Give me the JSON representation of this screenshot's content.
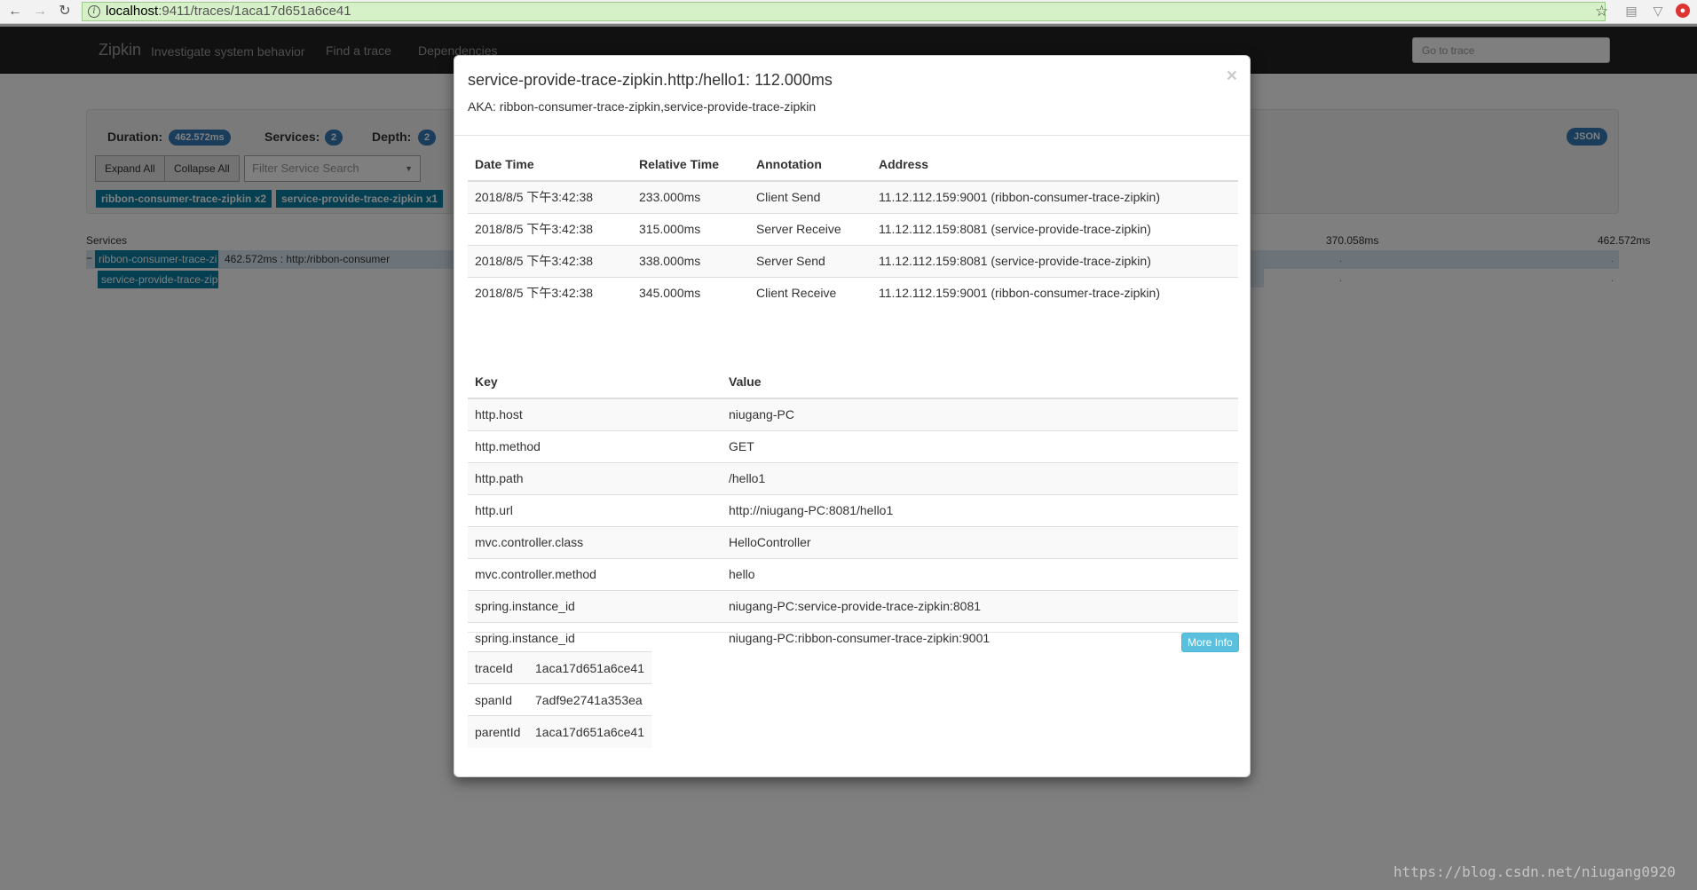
{
  "browser": {
    "back_glyph": "←",
    "forward_glyph": "→",
    "reload_glyph": "↻",
    "url_host": "localhost",
    "url_path": ":9411/traces/1aca17d651a6ce41",
    "star_glyph": "☆"
  },
  "navbar": {
    "brand": "Zipkin",
    "tagline": "Investigate system behavior",
    "links": [
      "Find a trace",
      "Dependencies"
    ],
    "goto_placeholder": "Go to trace"
  },
  "trace_summary": {
    "duration_label": "Duration:",
    "duration_value": "462.572ms",
    "services_label": "Services:",
    "services_value": "2",
    "depth_label": "Depth:",
    "depth_value": "2",
    "expand_all": "Expand All",
    "collapse_all": "Collapse All",
    "filter_placeholder": "Filter Service Search",
    "json_label": "JSON",
    "service_tags": [
      "ribbon-consumer-trace-zipkin x2",
      "service-provide-trace-zipkin x1"
    ]
  },
  "timeline": {
    "services_label": "Services",
    "ticks": [
      "370.058ms",
      "462.572ms"
    ],
    "rows": [
      {
        "service": "ribbon-consumer-trace-zi",
        "label": "462.572ms : http:/ribbon-consumer"
      },
      {
        "service": "service-provide-trace-zipk",
        "label": ""
      }
    ],
    "collapse_glyph": "−"
  },
  "modal": {
    "title": "service-provide-trace-zipkin.http:/hello1: 112.000ms",
    "aka": "AKA: ribbon-consumer-trace-zipkin,service-provide-trace-zipkin",
    "close_glyph": "×",
    "annotations": {
      "headers": [
        "Date Time",
        "Relative Time",
        "Annotation",
        "Address"
      ],
      "rows": [
        [
          "2018/8/5 下午3:42:38",
          "233.000ms",
          "Client Send",
          "11.12.112.159:9001 (ribbon-consumer-trace-zipkin)"
        ],
        [
          "2018/8/5 下午3:42:38",
          "315.000ms",
          "Server Receive",
          "11.12.112.159:8081 (service-provide-trace-zipkin)"
        ],
        [
          "2018/8/5 下午3:42:38",
          "338.000ms",
          "Server Send",
          "11.12.112.159:8081 (service-provide-trace-zipkin)"
        ],
        [
          "2018/8/5 下午3:42:38",
          "345.000ms",
          "Client Receive",
          "11.12.112.159:9001 (ribbon-consumer-trace-zipkin)"
        ]
      ]
    },
    "tags": {
      "headers": [
        "Key",
        "Value"
      ],
      "rows": [
        [
          "http.host",
          "niugang-PC"
        ],
        [
          "http.method",
          "GET"
        ],
        [
          "http.path",
          "/hello1"
        ],
        [
          "http.url",
          "http://niugang-PC:8081/hello1"
        ],
        [
          "mvc.controller.class",
          "HelloController"
        ],
        [
          "mvc.controller.method",
          "hello"
        ],
        [
          "spring.instance_id",
          "niugang-PC:service-provide-trace-zipkin:8081"
        ],
        [
          "spring.instance_id",
          "niugang-PC:ribbon-consumer-trace-zipkin:9001"
        ]
      ]
    },
    "more_info": "More Info",
    "ids": [
      [
        "traceId",
        "1aca17d651a6ce41"
      ],
      [
        "spanId",
        "7adf9e2741a353ea"
      ],
      [
        "parentId",
        "1aca17d651a6ce41"
      ]
    ]
  },
  "watermark": "https://blog.csdn.net/niugang0920",
  "colors": {
    "zipkin_service": "#0b7fa5",
    "badge_blue": "#337ab7",
    "info_button": "#5bc0de",
    "url_bar_secure": "#d6f0c8"
  }
}
